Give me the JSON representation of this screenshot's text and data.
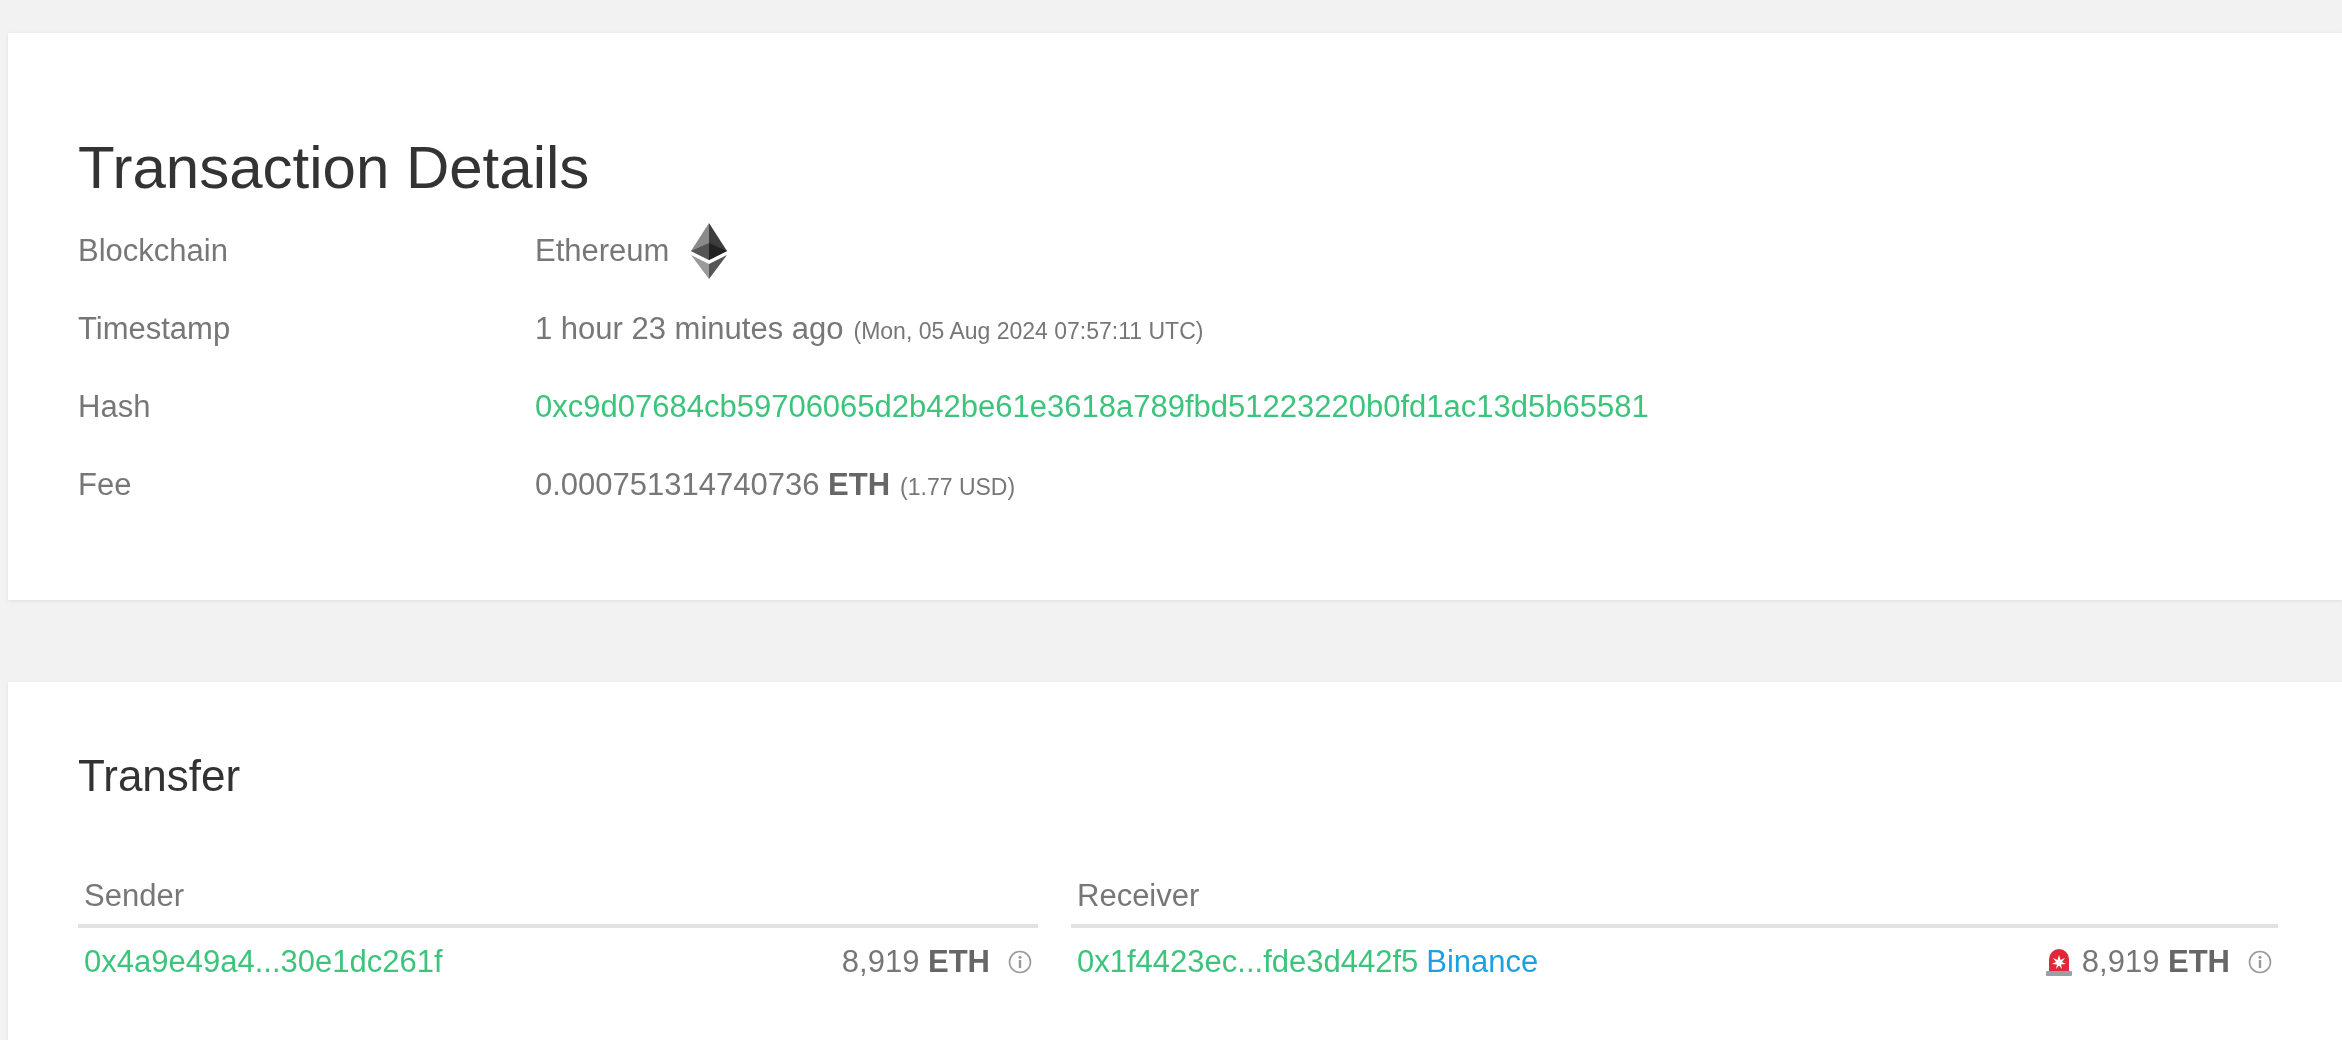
{
  "title": "Transaction Details",
  "details": [
    {
      "label": "Blockchain",
      "kind": "chain",
      "value": "Ethereum"
    },
    {
      "label": "Timestamp",
      "kind": "time",
      "value": "1 hour 23 minutes ago",
      "note": "(Mon, 05 Aug 2024 07:57:11 UTC)"
    },
    {
      "label": "Hash",
      "kind": "link",
      "value": "0xc9d07684cb59706065d2b42be61e3618a789fbd51223220b0fd1ac13d5b65581"
    },
    {
      "label": "Fee",
      "kind": "amount",
      "value": "0.000751314740736 **ETH**",
      "note": "(1.77 USD)"
    }
  ],
  "transfer": {
    "title": "Transfer",
    "sides": [
      {
        "heading": "Sender",
        "address": "0x4a9e49a4...30e1dc261f",
        "alert": false,
        "amount": "8,919 **ETH**"
      },
      {
        "heading": "Receiver",
        "address": "0x1f4423ec...fde3d442f5",
        "entity": "Binance",
        "alert": true,
        "amount": "8,919 **ETH**"
      }
    ]
  }
}
